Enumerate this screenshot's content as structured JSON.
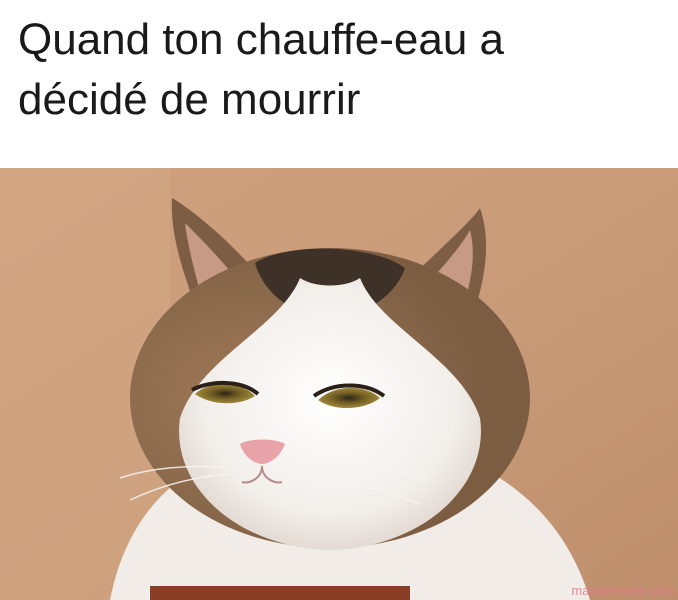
{
  "caption": {
    "line1": "Quand ton chauffe-eau a",
    "line2": "décidé de mourrir"
  },
  "photo": {
    "subject": "cat-photo",
    "background_color": "#c89a78",
    "fur_white": "#f4f1ee",
    "fur_brown": "#8a6a4c",
    "fur_dark": "#3e3128"
  },
  "watermark": {
    "text": "makeitmeme.com",
    "color": "#e5788a"
  }
}
